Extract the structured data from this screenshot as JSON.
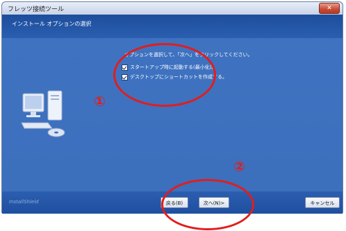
{
  "window": {
    "title": "フレッツ接続ツール",
    "close_symbol": "✕"
  },
  "header": {
    "title": "インストール オプションの選択"
  },
  "content": {
    "instruction": "オプションを選択して、「次へ」をクリックしてください。",
    "options": [
      {
        "label": "スタートアップ時に起動する(最小化)。",
        "checked": true
      },
      {
        "label": "デスクトップにショートカットを作成する。",
        "checked": true
      }
    ],
    "graphic_icon": "computer-icon"
  },
  "footer": {
    "brand": "InstallShield",
    "back_label": "戻る(B)",
    "next_label": "次へ(N)>",
    "cancel_label": "キャンセル"
  },
  "annotations": {
    "marker_1": "①",
    "marker_2": "②",
    "color": "#e21d1d"
  }
}
